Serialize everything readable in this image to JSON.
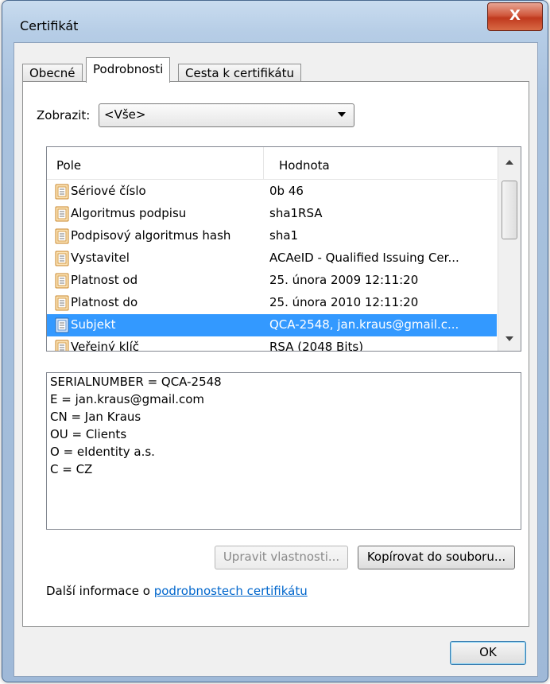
{
  "window": {
    "title": "Certifikát",
    "close_glyph": "X"
  },
  "tabs": [
    {
      "label": "Obecné"
    },
    {
      "label": "Podrobnosti"
    },
    {
      "label": "Cesta k certifikátu"
    }
  ],
  "show": {
    "label": "Zobrazit:",
    "value": "<Vše>"
  },
  "list": {
    "headers": {
      "field": "Pole",
      "value": "Hodnota"
    },
    "rows": [
      {
        "field": "Sériové číslo",
        "value": "0b 46"
      },
      {
        "field": "Algoritmus podpisu",
        "value": "sha1RSA"
      },
      {
        "field": "Podpisový algoritmus hash",
        "value": "sha1"
      },
      {
        "field": "Vystavitel",
        "value": "ACAeID - Qualified Issuing Cer..."
      },
      {
        "field": "Platnost od",
        "value": "25. února 2009 12:11:20"
      },
      {
        "field": "Platnost do",
        "value": "25. února 2010 12:11:20"
      },
      {
        "field": "Subjekt",
        "value": "QCA-2548, jan.kraus@gmail.c..."
      },
      {
        "field": "Veřejný klíč",
        "value": "RSA (2048 Bits)"
      }
    ],
    "selected_index": 6
  },
  "detail_lines": [
    "SERIALNUMBER = QCA-2548",
    "E = jan.kraus@gmail.com",
    "CN = Jan Kraus",
    "OU = Clients",
    "O = eIdentity a.s.",
    "C = CZ"
  ],
  "buttons": {
    "edit_properties": "Upravit vlastnosti...",
    "copy_to_file": "Kopírovat do souboru...",
    "ok": "OK"
  },
  "more_info": {
    "prefix": "Další informace o ",
    "link": "podrobnostech certifikátu"
  },
  "colors": {
    "selection": "#3399ff",
    "link": "#0066cc",
    "close": "#c0391e"
  }
}
